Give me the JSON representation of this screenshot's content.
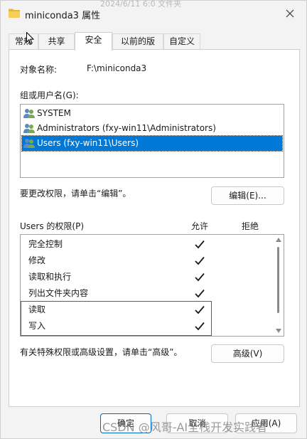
{
  "window": {
    "title": "miniconda3 属性",
    "ghost_header": "2024/6/11 6:0     文件夹"
  },
  "tabs": [
    {
      "label": "常规"
    },
    {
      "label": "共享"
    },
    {
      "label": "安全"
    },
    {
      "label": "以前的版本"
    },
    {
      "label": "自定义"
    }
  ],
  "object": {
    "label": "对象名称:",
    "value": "F:\\miniconda3"
  },
  "groups": {
    "label": "组或用户名(G):",
    "items": [
      {
        "name": "SYSTEM"
      },
      {
        "name": "Administrators (fxy-win11\\Administrators)"
      },
      {
        "name": "Users (fxy-win11\\Users)"
      }
    ],
    "selected_index": 2
  },
  "edit": {
    "hint": "要更改权限，请单击“编辑”。",
    "button": "编辑(E)..."
  },
  "permissions": {
    "title": "Users 的权限(P)",
    "allow_header": "允许",
    "deny_header": "拒绝",
    "rows": [
      {
        "name": "完全控制",
        "allow": true
      },
      {
        "name": "修改",
        "allow": true
      },
      {
        "name": "读取和执行",
        "allow": true
      },
      {
        "name": "列出文件夹内容",
        "allow": true
      },
      {
        "name": "读取",
        "allow": true
      },
      {
        "name": "写入",
        "allow": true
      }
    ]
  },
  "advanced": {
    "hint": "有关特殊权限或高级设置，请单击“高级”。",
    "button": "高级(V)"
  },
  "footer": {
    "ok": "确定",
    "cancel": "取消",
    "apply": "应用(A)"
  },
  "watermark": "CSDN @风哥-AI全栈开发实践者",
  "colors": {
    "accent": "#0078d7",
    "highlight": "#d42a2a"
  }
}
